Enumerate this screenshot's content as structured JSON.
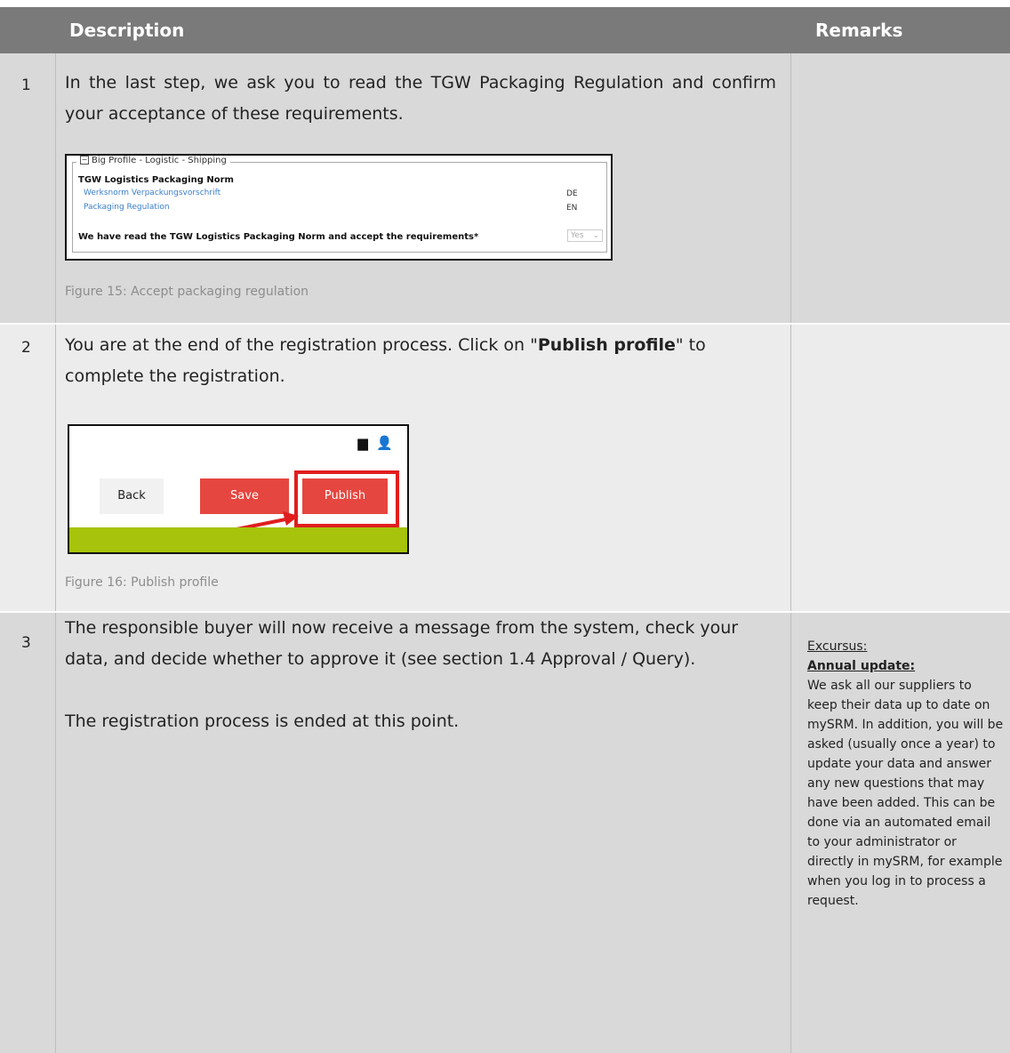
{
  "header": {
    "col_description": "Description",
    "col_remarks": "Remarks"
  },
  "rows": [
    {
      "num": "1",
      "text": "In the last step, we ask you to read the TGW Packaging Regulation and confirm your acceptance of these requirements.",
      "caption": "Figure 15: Accept packaging regulation",
      "figure": {
        "legend": "Big Profile - Logistic - Shipping",
        "title": "TGW Logistics Packaging Norm",
        "links": [
          {
            "label": "Werksnorm Verpackungsvorschrift",
            "code": "DE"
          },
          {
            "label": "Packaging Regulation",
            "code": "EN"
          }
        ],
        "accept_text": "We have read the TGW Logistics Packaging Norm and accept the requirements*",
        "select_value": "Yes"
      }
    },
    {
      "num": "2",
      "text_before": "You are at the end of the registration process. Click on \"",
      "text_bold": "Publish profile",
      "text_after": "\" to complete the registration.",
      "caption": "Figure 16: Publish profile",
      "figure": {
        "back": "Back",
        "save": "Save",
        "publish": "Publish"
      }
    },
    {
      "num": "3",
      "text1": "The responsible buyer will now receive a message from the system, check your data, and decide whether to approve it (see section 1.4 Approval / Query).",
      "text2": "The registration process is ended at this point.",
      "remark_label": "Excursus:",
      "remark_title": "Annual update:",
      "remark_body": "We ask all our suppliers to keep their data up to date on mySRM. In addition, you will be asked (usually once a year) to update your data and answer any new questions that may have been added. This can be done via an automated email to your administrator or directly in mySRM, for example when you log in to process a request."
    }
  ],
  "colors": {
    "header_bg": "#7a7a7a",
    "row_dark": "#d9d9d9",
    "row_light": "#ececec",
    "accent_red": "#e5463f",
    "green_bar": "#a7c30b"
  }
}
